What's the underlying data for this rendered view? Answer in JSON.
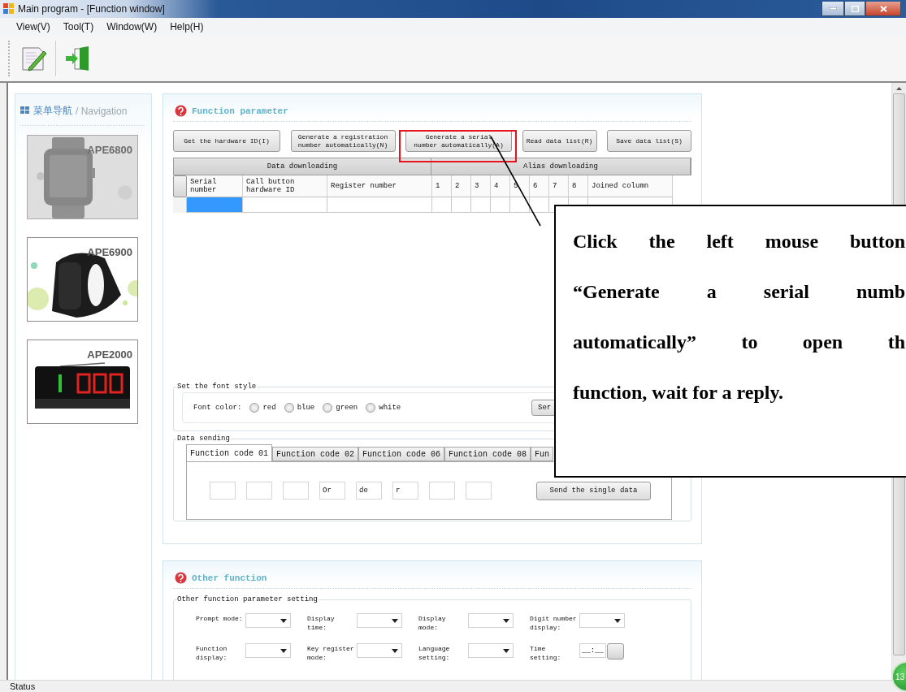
{
  "window": {
    "title": "Main program - [Function window]"
  },
  "menu": [
    "View(V)",
    "Tool(T)",
    "Window(W)",
    "Help(H)"
  ],
  "navigation": {
    "title": "菜单导航",
    "subtitle": "/ Navigation",
    "items": [
      {
        "label": "APE6800",
        "kind": "watch",
        "selected": true
      },
      {
        "label": "APE6900",
        "kind": "band",
        "selected": false
      },
      {
        "label": "APE2000",
        "kind": "display",
        "selected": false
      }
    ]
  },
  "function_parameter": {
    "title": "Function parameter",
    "buttons": [
      "Get the hardware ID(I)",
      "Generate a registration\nnumber automatically(N)",
      "Generate a serial\nnumber automatically(A)",
      "Read data list(R)",
      "Save data list(S)"
    ],
    "table": {
      "groups": [
        "Data downloading",
        "Alias downloading"
      ],
      "columns": [
        "Serial\nnumber",
        "Call button\nhardware ID",
        "Register number",
        "1",
        "2",
        "3",
        "4",
        "5",
        "6",
        "7",
        "8",
        "Joined column"
      ],
      "rows": [
        {
          "cells": [
            {
              "selected": true
            },
            {
              "selected": false
            },
            {
              "selected": false
            },
            {
              "selected": false
            },
            {
              "selected": false
            },
            {
              "selected": false
            },
            {
              "selected": false
            },
            {
              "selected": false
            },
            {
              "selected": false
            },
            {
              "selected": false
            },
            {
              "selected": false
            },
            {
              "selected": false
            }
          ]
        }
      ]
    },
    "font_style": {
      "legend": "Set the font style",
      "label": "Font color:",
      "options": [
        {
          "label": "red",
          "selected": false
        },
        {
          "label": "blue",
          "selected": false
        },
        {
          "label": "green",
          "selected": false
        },
        {
          "label": "white",
          "selected": false
        }
      ],
      "button": "Ser"
    },
    "data_sending": {
      "legend": "Data sending",
      "tabs": [
        {
          "label": "Function code 01",
          "selected": true
        },
        {
          "label": "Function code 02",
          "selected": false
        },
        {
          "label": "Function code 06",
          "selected": false
        },
        {
          "label": "Function code 08",
          "selected": false
        },
        {
          "label": "Fun",
          "selected": false
        }
      ],
      "fields": [
        {
          "kind": "blank"
        },
        {
          "kind": "blank"
        },
        {
          "kind": "blank"
        },
        {
          "kind": "text",
          "value": "Or"
        },
        {
          "kind": "text",
          "value": "de"
        },
        {
          "kind": "text",
          "value": "r"
        },
        {
          "kind": "blank"
        },
        {
          "kind": "blank"
        }
      ],
      "button": "Send the single data"
    }
  },
  "other_function": {
    "title": "Other function",
    "legend": "Other function parameter setting",
    "settings": [
      {
        "label": "Prompt mode:",
        "kind": "select"
      },
      {
        "label": "Display\ntime:",
        "kind": "select"
      },
      {
        "label": "Display\nmode:",
        "kind": "select"
      },
      {
        "label": "Digit number\ndisplay:",
        "kind": "select"
      },
      {
        "label": "Function\ndisplay:",
        "kind": "select"
      },
      {
        "label": "Key register\nmode:",
        "kind": "select"
      },
      {
        "label": "Language\nsetting:",
        "kind": "select"
      },
      {
        "label": "Time\nsetting:",
        "kind": "time",
        "value": "__:__"
      }
    ]
  },
  "callout": {
    "lines": [
      "Click the left mouse button",
      "“Generate a serial numb",
      "automatically” to open th",
      "function, wait for a reply."
    ]
  },
  "status_bar": {
    "text": "Status",
    "badge": "13"
  }
}
